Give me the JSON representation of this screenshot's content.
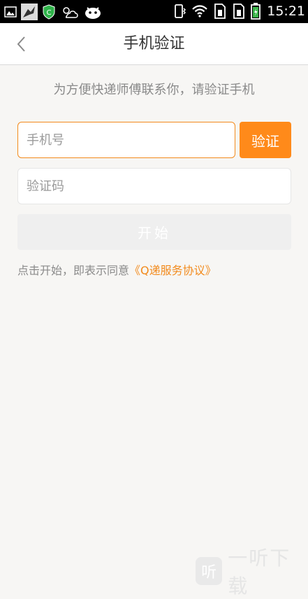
{
  "status_bar": {
    "time": "15:21",
    "icons_left": [
      "gallery-icon",
      "bird-icon",
      "shield-app-icon",
      "weather-icon",
      "robot-icon"
    ],
    "icons_right": [
      "vibrate-icon",
      "wifi-icon",
      "sim1-icon",
      "sim2-icon",
      "battery-icon"
    ]
  },
  "header": {
    "title": "手机验证",
    "back_icon": "chevron-left-icon"
  },
  "main": {
    "hint": "为方便快递师傅联系你，请验证手机",
    "phone_placeholder": "手机号",
    "verify_label": "验证",
    "code_placeholder": "验证码",
    "start_label": "开始",
    "agree_prefix": "点击开始，即表示同意",
    "agree_link": "《Q递服务协议》"
  },
  "watermark": {
    "logo_glyph": "听",
    "text": "一听下载"
  },
  "colors": {
    "accent": "#ff8a1a",
    "background": "#f7f6f4",
    "statusbar": "#000000"
  }
}
